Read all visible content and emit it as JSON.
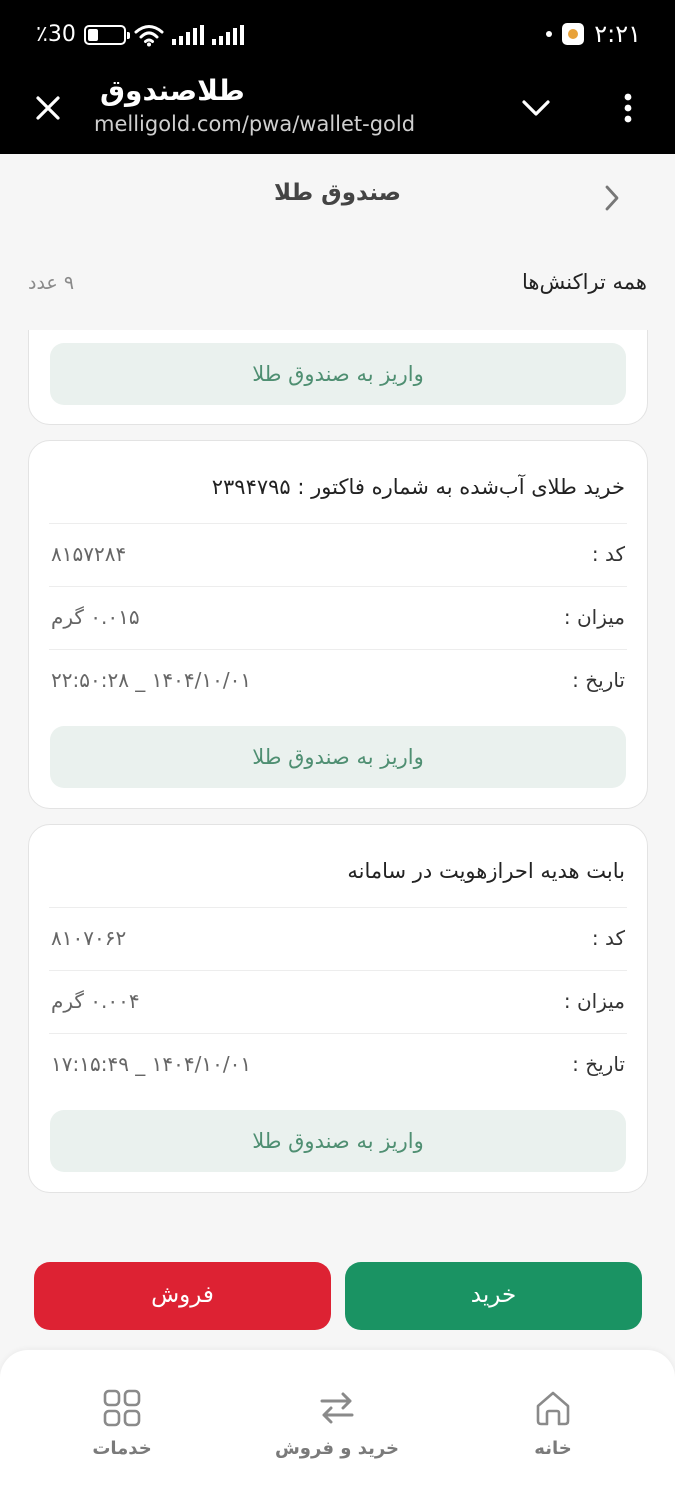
{
  "status_bar": {
    "battery_text": "٪30",
    "battery_level": 0.3,
    "time": "۲:۲۱"
  },
  "browser": {
    "page_title": "طلاصندوق",
    "url": "melligold.com/pwa/wallet-gold"
  },
  "header": {
    "title": "صندوق طلا"
  },
  "section": {
    "title": "همه تراکنش‌ها",
    "count": "۹ عدد"
  },
  "cards": [
    {
      "deposit_label": "واریز به صندوق طلا"
    },
    {
      "title": "خرید طلای آب‌شده به شماره فاکتور : ۲۳۹۴۷۹۵",
      "code_label": "کد :",
      "code_value": "۸۱۵۷۲۸۴",
      "amount_label": "میزان :",
      "amount_value": "۰.۰۱۵ گرم",
      "date_label": "تاریخ :",
      "date_value": "۱۴۰۴/۱۰/۰۱ _ ۲۲:۵۰:۲۸",
      "deposit_label": "واریز به صندوق طلا"
    },
    {
      "title": "بابت هدیه احرازهویت در سامانه",
      "code_label": "کد :",
      "code_value": "۸۱۰۷۰۶۲",
      "amount_label": "میزان :",
      "amount_value": "۰.۰۰۴ گرم",
      "date_label": "تاریخ :",
      "date_value": "۱۴۰۴/۱۰/۰۱ _ ۱۷:۱۵:۴۹",
      "deposit_label": "واریز به صندوق طلا"
    }
  ],
  "actions": {
    "buy_label": "خرید",
    "sell_label": "فروش"
  },
  "bottom_nav": {
    "items": [
      {
        "label": "خانه",
        "icon": "home-icon"
      },
      {
        "label": "خرید و فروش",
        "icon": "swap-arrows-icon"
      },
      {
        "label": "خدمات",
        "icon": "grid-icon"
      }
    ]
  },
  "colors": {
    "buy": "#1a9363",
    "sell": "#dd2233",
    "deposit_bg": "#eaf1ee",
    "deposit_text": "#4f8f72"
  }
}
